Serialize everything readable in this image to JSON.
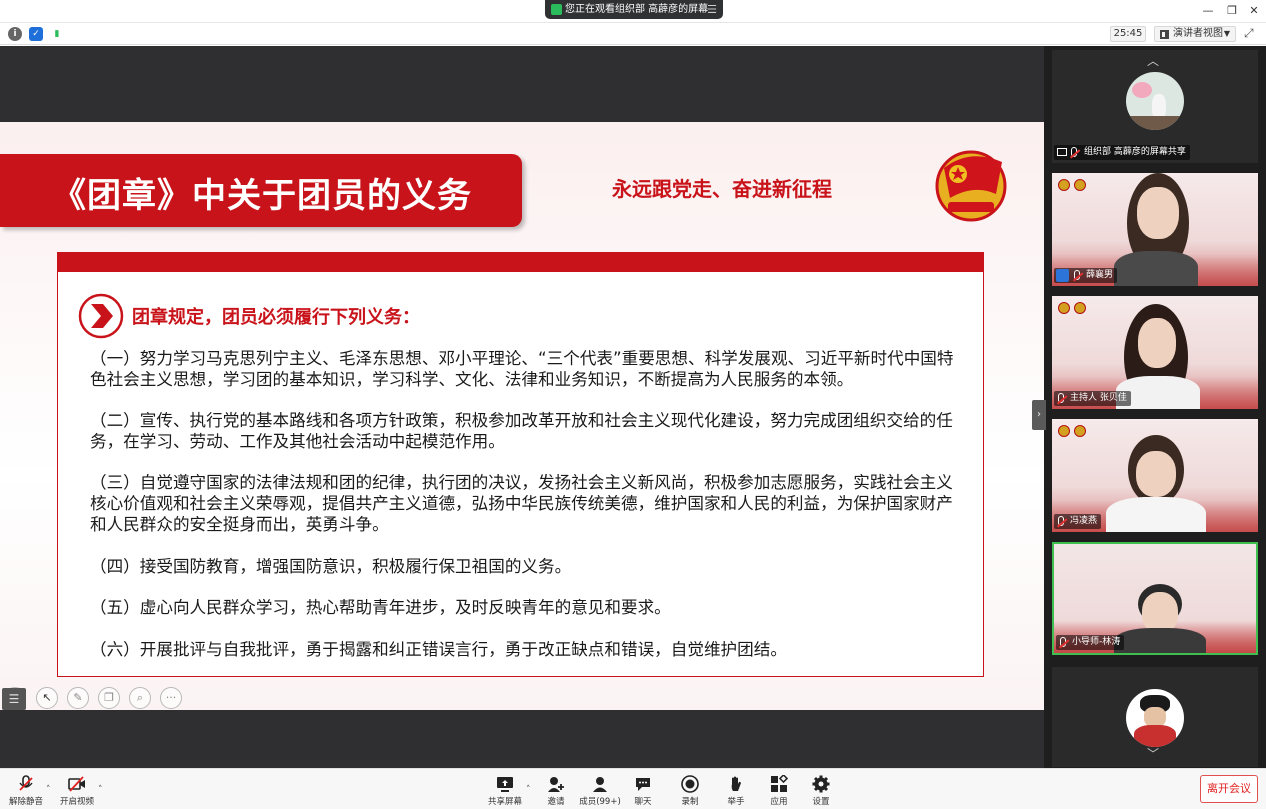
{
  "titlebar": {
    "share_banner": "您正在观看组织部 高薜彦的屏幕",
    "menu_glyph": "☰",
    "minimize": "—",
    "restore": "❐",
    "close": "✕"
  },
  "toolbar": {
    "timer": "25:45",
    "view_mode": "演讲者视图"
  },
  "slide": {
    "title": "《团章》中关于团员的义务",
    "slogan": "永远跟党走、奋进新征程",
    "section_heading": "团章规定，团员必须履行下列义务：",
    "duties": [
      "（一）努力学习马克思列宁主义、毛泽东思想、邓小平理论、“三个代表”重要思想、科学发展观、习近平新时代中国特色社会主义思想，学习团的基本知识，学习科学、文化、法律和业务知识，不断提高为人民服务的本领。",
      "（二）宣传、执行党的基本路线和各项方针政策，积极参加改革开放和社会主义现代化建设，努力完成团组织交给的任务，在学习、劳动、工作及其他社会活动中起模范作用。",
      "（三）自觉遵守国家的法律法规和团的纪律，执行团的决议，发扬社会主义新风尚，积极参加志愿服务，实践社会主义核心价值观和社会主义荣辱观，提倡共产主义道德，弘扬中华民族传统美德，维护国家和人民的利益，为保护国家财产和人民群众的安全挺身而出，英勇斗争。",
      "（四）接受国防教育，增强国防意识，积极履行保卫祖国的义务。",
      "（五）虚心向人民群众学习，热心帮助青年进步，及时反映青年的意见和要求。",
      "（六）开展批评与自我批评，勇于揭露和纠正错误言行，勇于改正缺点和错误，自觉维护团结。"
    ]
  },
  "participants": [
    {
      "name": "组织部 高薜彦的屏幕共享"
    },
    {
      "name": "薛襄男"
    },
    {
      "name": "主持人 张贝佳"
    },
    {
      "name": "冯凌燕"
    },
    {
      "name": "小导师-林涛"
    }
  ],
  "controls": {
    "unmute": "解除静音",
    "start_video": "开启视频",
    "share_screen": "共享屏幕",
    "invite": "邀请",
    "members": "成员(99+)",
    "chat": "聊天",
    "record": "录制",
    "raise_hand": "举手",
    "apps": "应用",
    "settings": "设置",
    "leave": "离开会议"
  },
  "colors": {
    "accent_red": "#c9131a",
    "active_speaker_border": "#3fbf4f",
    "leave_red": "#e02020"
  }
}
